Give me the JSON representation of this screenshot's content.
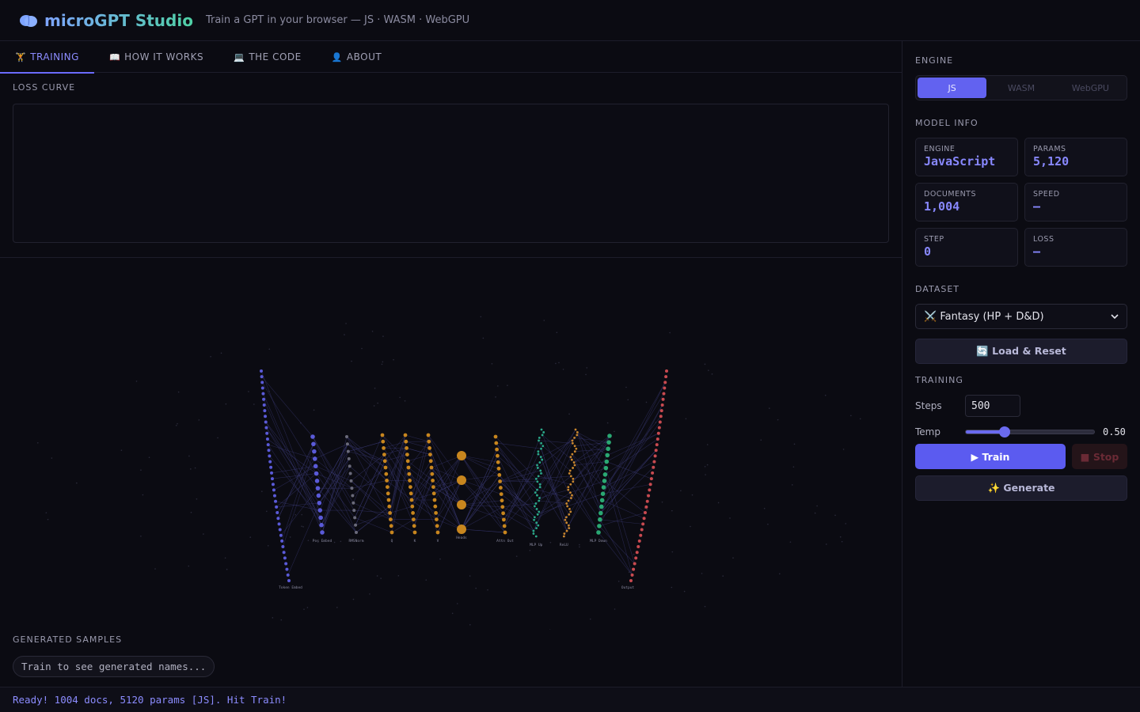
{
  "header": {
    "logo_icon": "brain-icon",
    "title": "microGPT Studio",
    "subtitle": "Train a GPT in your browser — JS · WASM · WebGPU"
  },
  "tabs": [
    {
      "icon": "🏋",
      "label": "TRAINING",
      "active": true
    },
    {
      "icon": "📖",
      "label": "HOW IT WORKS",
      "active": false
    },
    {
      "icon": "💻",
      "label": "THE CODE",
      "active": false
    },
    {
      "icon": "👤",
      "label": "ABOUT",
      "active": false
    }
  ],
  "loss": {
    "label": "LOSS CURVE"
  },
  "samples": {
    "label": "GENERATED SAMPLES",
    "placeholder": "Train to see generated names..."
  },
  "status": "Ready! 1004 docs, 5120 params [JS]. Hit Train!",
  "sidebar": {
    "engine_label": "ENGINE",
    "engines": [
      {
        "label": "JS",
        "active": true
      },
      {
        "label": "WASM",
        "active": false
      },
      {
        "label": "WebGPU",
        "active": false
      }
    ],
    "model_info_label": "MODEL INFO",
    "info": [
      {
        "key": "ENGINE",
        "value": "JavaScript"
      },
      {
        "key": "PARAMS",
        "value": "5,120"
      },
      {
        "key": "DOCUMENTS",
        "value": "1,004"
      },
      {
        "key": "SPEED",
        "value": "—"
      },
      {
        "key": "STEP",
        "value": "0"
      },
      {
        "key": "LOSS",
        "value": "—"
      }
    ],
    "dataset_label": "DATASET",
    "dataset_value": "⚔️ Fantasy (HP + D&D)",
    "load_reset": "🔄 Load & Reset",
    "training_label": "TRAINING",
    "steps_label": "Steps",
    "steps_value": "500",
    "temp_label": "Temp",
    "temp_value": "0.50",
    "temp_fraction": 0.3,
    "train_btn": "▶ Train",
    "stop_btn": "■ Stop",
    "generate_btn": "✨ Generate"
  },
  "colors": {
    "accent": "#6262f0",
    "background": "#0b0b12",
    "token_embed": "#5a5ad8",
    "pos_embed": "#5a5ad8",
    "rmsnorm": "#6a6a7a",
    "attention": "#c8861e",
    "mlp_up": "#2aa889",
    "relu": "#c8862e",
    "mlp_down": "#2aa873",
    "output": "#c84a50"
  },
  "viz_layers": [
    {
      "label": "Token Embed",
      "color": "#5a5ad8"
    },
    {
      "label": "Pos Embed",
      "color": "#5a5ad8"
    },
    {
      "label": "RMSNorm",
      "color": "#6a6a7a"
    },
    {
      "label": "Q",
      "color": "#c8861e"
    },
    {
      "label": "K",
      "color": "#c8861e"
    },
    {
      "label": "V",
      "color": "#c8861e"
    },
    {
      "label": "Heads",
      "color": "#c8861e"
    },
    {
      "label": "Attn Out",
      "color": "#c8861e"
    },
    {
      "label": "MLP Up",
      "color": "#2aa889"
    },
    {
      "label": "ReLU",
      "color": "#c8862e"
    },
    {
      "label": "MLP Down",
      "color": "#2aa873"
    },
    {
      "label": "Output",
      "color": "#c84a50"
    }
  ]
}
